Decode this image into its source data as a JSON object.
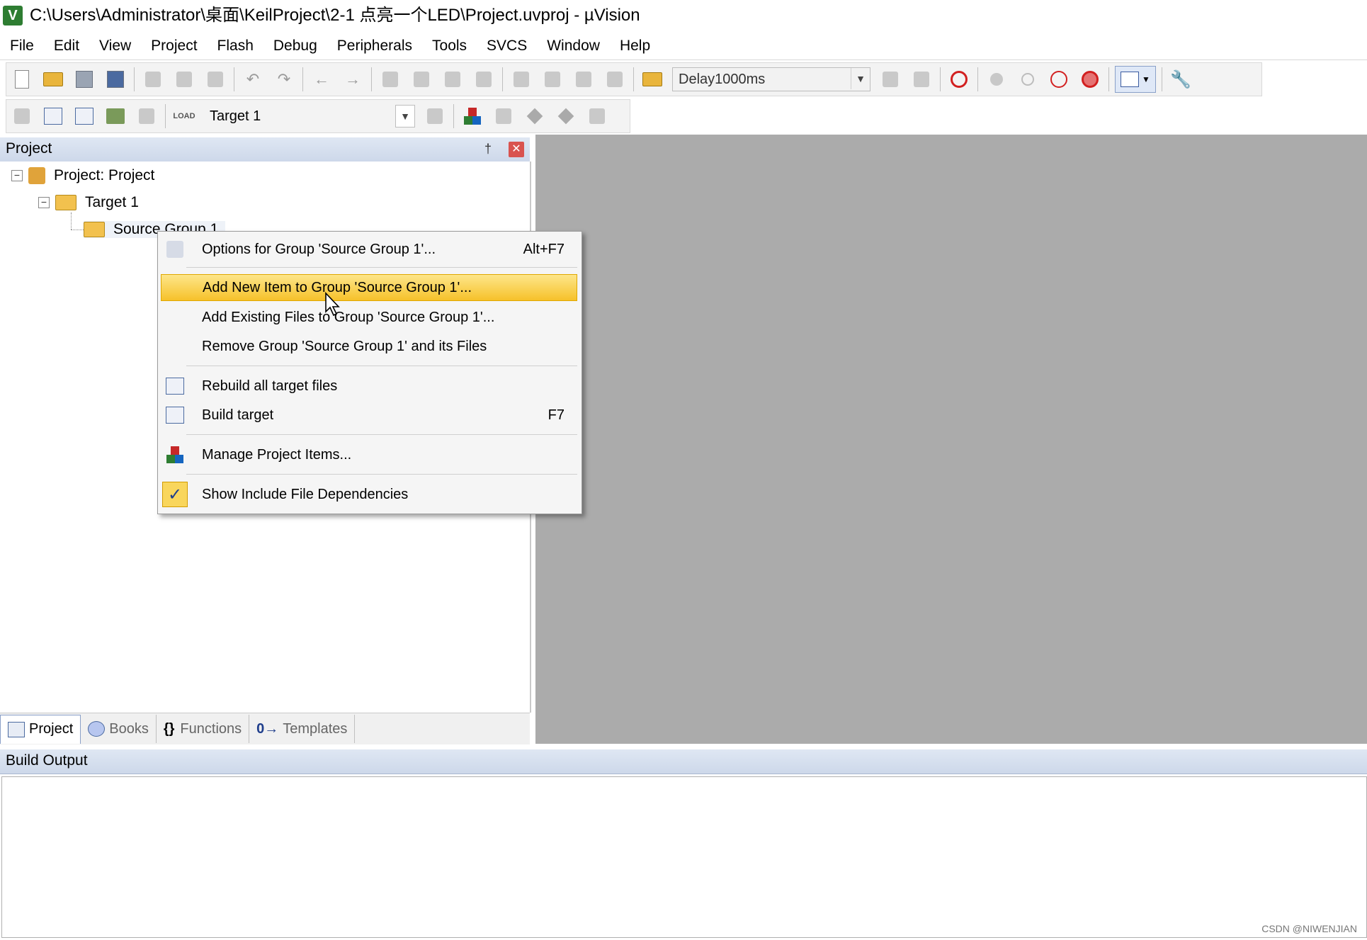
{
  "window": {
    "title": "C:\\Users\\Administrator\\桌面\\KeilProject\\2-1 点亮一个LED\\Project.uvproj - µVision",
    "app_icon_glyph": "V"
  },
  "menubar": [
    "File",
    "Edit",
    "View",
    "Project",
    "Flash",
    "Debug",
    "Peripherals",
    "Tools",
    "SVCS",
    "Window",
    "Help"
  ],
  "toolbar1": {
    "function_combo": "Delay1000ms"
  },
  "toolbar2": {
    "target_combo": "Target 1",
    "load_label": "LOAD"
  },
  "project_pane": {
    "title": "Project",
    "pin_glyph": "†",
    "close_glyph": "✕",
    "tree": {
      "root": "Project: Project",
      "target": "Target 1",
      "group": "Source Group 1"
    },
    "tabs": [
      {
        "label": "Project",
        "icon": "project-icon"
      },
      {
        "label": "Books",
        "icon": "books-icon"
      },
      {
        "label": "Functions",
        "icon": "functions-icon",
        "glyph": "{}"
      },
      {
        "label": "Templates",
        "icon": "templates-icon",
        "glyph": "0→"
      }
    ]
  },
  "context_menu": {
    "items": [
      {
        "label": "Options for Group 'Source Group 1'...",
        "shortcut": "Alt+F7",
        "icon": "options-icon"
      },
      {
        "label": "Add New  Item to Group 'Source Group 1'...",
        "shortcut": "",
        "highlighted": true
      },
      {
        "label": "Add Existing Files to Group 'Source Group 1'...",
        "shortcut": ""
      },
      {
        "label": "Remove Group 'Source Group 1' and its Files",
        "shortcut": ""
      },
      {
        "label": "Rebuild all target files",
        "shortcut": "",
        "icon": "rebuild-icon"
      },
      {
        "label": "Build target",
        "shortcut": "F7",
        "icon": "build-icon"
      },
      {
        "label": "Manage Project Items...",
        "shortcut": "",
        "icon": "manage-items-icon"
      },
      {
        "label": "Show Include File Dependencies",
        "shortcut": "",
        "icon": "checkmark-icon",
        "checked": true,
        "check_glyph": "✓"
      }
    ]
  },
  "build_output": {
    "title": "Build Output"
  },
  "watermark": "CSDN @NIWENJIAN",
  "colors": {
    "highlight": "#f6c12a",
    "pane_header": "#cdd8ea",
    "editor_bg": "#ababab"
  }
}
